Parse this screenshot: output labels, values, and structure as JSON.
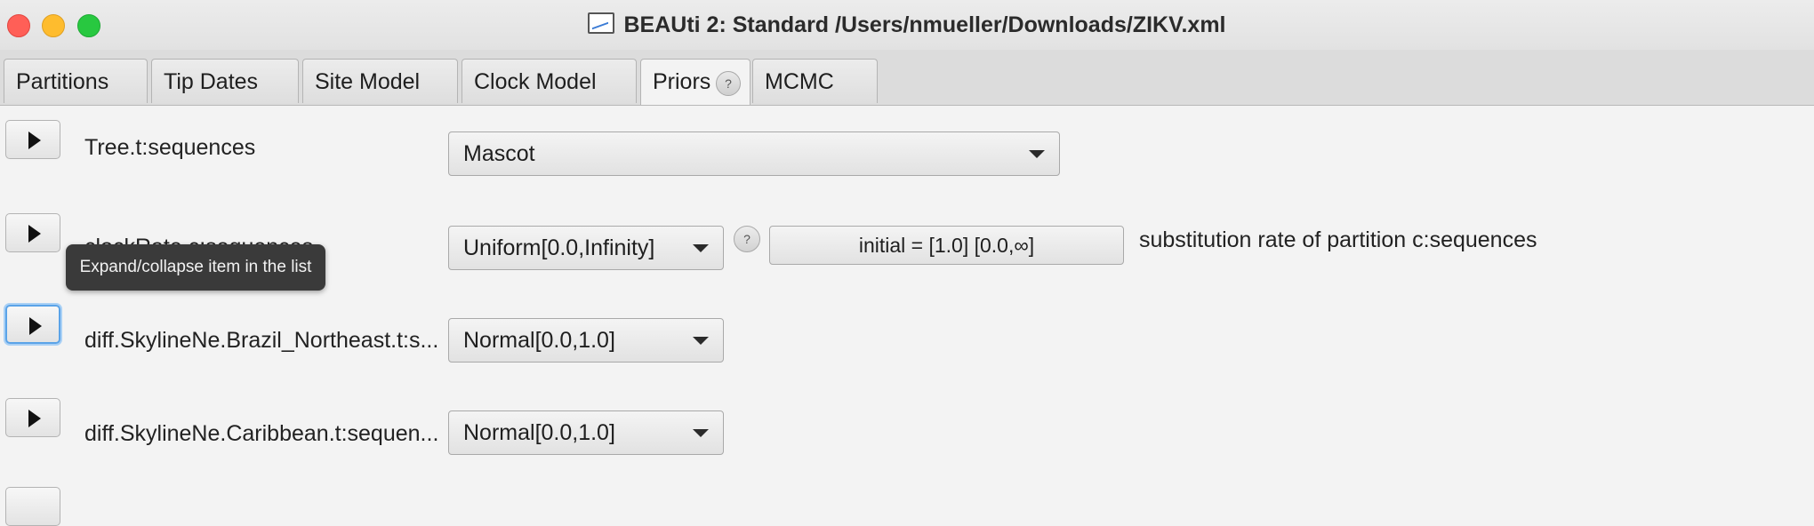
{
  "window": {
    "title": "BEAUti 2: Standard /Users/nmueller/Downloads/ZIKV.xml",
    "icon": "document-chart-icon"
  },
  "tabs": [
    {
      "label": "Partitions"
    },
    {
      "label": "Tip Dates"
    },
    {
      "label": "Site Model"
    },
    {
      "label": "Clock Model"
    },
    {
      "label": "Priors",
      "active": true,
      "help": "?"
    },
    {
      "label": "MCMC"
    }
  ],
  "rows": [
    {
      "label": "Tree.t:sequences",
      "prior": "Mascot"
    },
    {
      "label": "clockRate.c:sequences",
      "prior": "Uniform[0.0,Infinity]",
      "help": "?",
      "initial": "initial = [1.0] [0.0,∞]",
      "description": "substitution rate of partition c:sequences"
    },
    {
      "label": "diff.SkylineNe.Brazil_Northeast.t:s...",
      "prior": "Normal[0.0,1.0]"
    },
    {
      "label": "diff.SkylineNe.Caribbean.t:sequen...",
      "prior": "Normal[0.0,1.0]"
    }
  ],
  "tooltip": {
    "text": "Expand/collapse item in the list"
  }
}
